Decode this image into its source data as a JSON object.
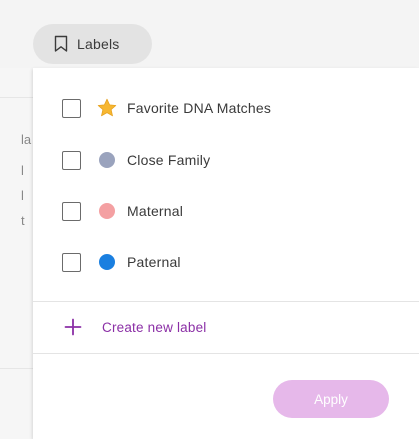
{
  "labels_button": {
    "label": "Labels",
    "icon": "bookmark-icon"
  },
  "label_options": [
    {
      "label": "Favorite DNA Matches",
      "icon": "star-icon",
      "color": "#f7b731",
      "checked": false
    },
    {
      "label": "Close Family",
      "icon": "dot-icon",
      "color": "#9aa3bd",
      "checked": false
    },
    {
      "label": "Maternal",
      "icon": "dot-icon",
      "color": "#f4a0a2",
      "checked": false
    },
    {
      "label": "Paternal",
      "icon": "dot-icon",
      "color": "#1a7fe0",
      "checked": false
    }
  ],
  "create_label": {
    "label": "Create new label",
    "icon": "plus-icon",
    "color": "#8b2fa6"
  },
  "apply_button": {
    "label": "Apply",
    "state": "disabled",
    "color": "#e6b8ea"
  },
  "background_fragments": [
    "la",
    "l",
    "l",
    "t"
  ]
}
